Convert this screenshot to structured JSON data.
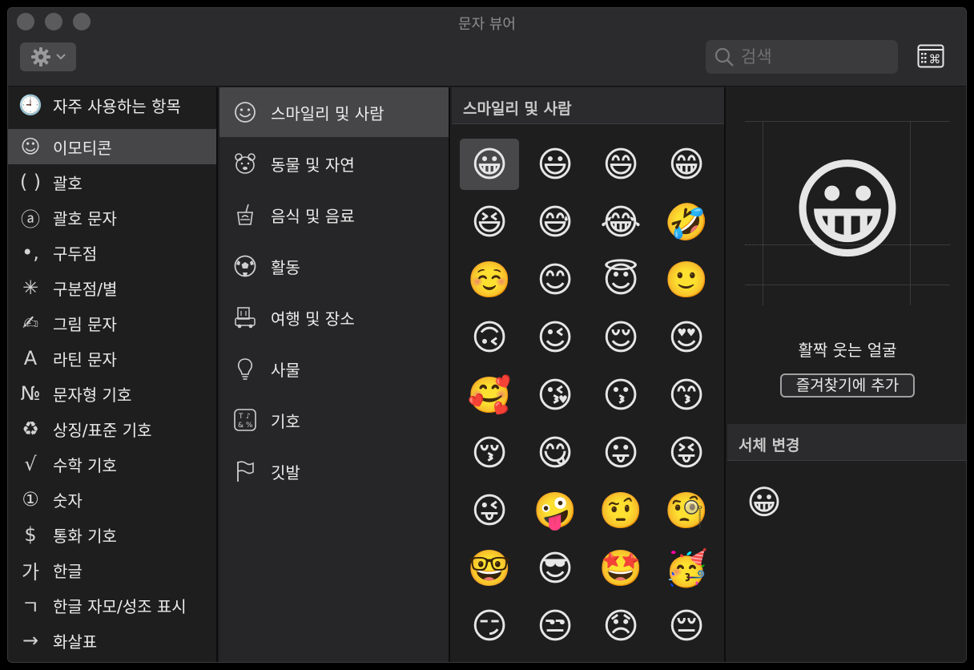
{
  "window": {
    "title": "문자 뷰어"
  },
  "toolbar": {
    "gear_icon": "gear-icon",
    "search_placeholder": "검색"
  },
  "categories": [
    {
      "icon": "🕘",
      "label": "자주 사용하는 항목",
      "selected": false
    },
    {
      "icon": "☺",
      "label": "이모티콘",
      "selected": true
    },
    {
      "icon": "( )",
      "label": "괄호",
      "selected": false
    },
    {
      "icon": "ⓐ",
      "label": "괄호 문자",
      "selected": false
    },
    {
      "icon": "•,",
      "label": "구두점",
      "selected": false
    },
    {
      "icon": "✳",
      "label": "구분점/별",
      "selected": false
    },
    {
      "icon": "✍",
      "label": "그림 문자",
      "selected": false
    },
    {
      "icon": "A",
      "label": "라틴 문자",
      "selected": false
    },
    {
      "icon": "№",
      "label": "문자형 기호",
      "selected": false
    },
    {
      "icon": "♻",
      "label": "상징/표준 기호",
      "selected": false
    },
    {
      "icon": "√",
      "label": "수학 기호",
      "selected": false
    },
    {
      "icon": "①",
      "label": "숫자",
      "selected": false
    },
    {
      "icon": "$",
      "label": "통화 기호",
      "selected": false
    },
    {
      "icon": "가",
      "label": "한글",
      "selected": false
    },
    {
      "icon": "ㄱ",
      "label": "한글 자모/성조 표시",
      "selected": false
    },
    {
      "icon": "→",
      "label": "화살표",
      "selected": false
    }
  ],
  "subcategories": [
    {
      "icon": "smiley-outline-icon",
      "label": "스마일리 및 사람",
      "selected": true
    },
    {
      "icon": "bear-outline-icon",
      "label": "동물 및 자연",
      "selected": false
    },
    {
      "icon": "food-outline-icon",
      "label": "음식 및 음료",
      "selected": false
    },
    {
      "icon": "soccer-ball-icon",
      "label": "활동",
      "selected": false
    },
    {
      "icon": "building-car-icon",
      "label": "여행 및 장소",
      "selected": false
    },
    {
      "icon": "lightbulb-icon",
      "label": "사물",
      "selected": false
    },
    {
      "icon": "symbols-icon",
      "label": "기호",
      "selected": false
    },
    {
      "icon": "flag-icon",
      "label": "깃발",
      "selected": false
    }
  ],
  "emoji_section": {
    "header": "스마일리 및 사람",
    "emojis": [
      "😀",
      "😃",
      "😄",
      "😁",
      "😆",
      "😅",
      "😂",
      "🤣",
      "☺️",
      "😊",
      "😇",
      "🙂",
      "🙃",
      "😉",
      "😌",
      "😍",
      "🥰",
      "😘",
      "😗",
      "😙",
      "😚",
      "😋",
      "😛",
      "😝",
      "😜",
      "🤪",
      "🤨",
      "🧐",
      "🤓",
      "😎",
      "🤩",
      "🥳",
      "😏",
      "😒",
      "😞",
      "😔"
    ],
    "selected_index": 0
  },
  "detail": {
    "emoji": "😀",
    "name": "활짝 웃는 얼굴",
    "favorite_button": "즐겨찾기에 추가",
    "font_variation_header": "서체 변경",
    "font_variations": [
      "😀"
    ]
  }
}
